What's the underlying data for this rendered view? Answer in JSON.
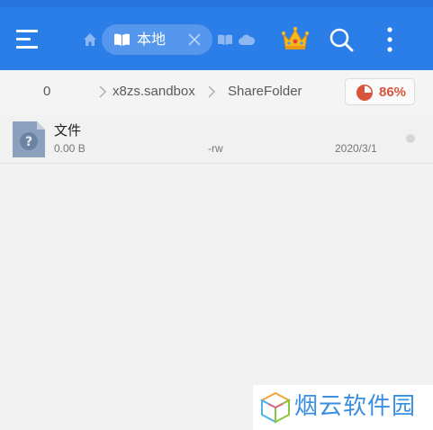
{
  "colors": {
    "appbar": "#2b7de8",
    "background": "#f1f1f1",
    "storage_accent": "#d9543d",
    "watermark_text": "#3a8ee0"
  },
  "appbar": {
    "menu_icon": "hamburger-menu-icon",
    "home_icon": "home-icon",
    "active_tab": {
      "icon": "book-icon",
      "label": "本地",
      "close_icon": "close-icon"
    },
    "extra_icons": [
      "book-icon",
      "cloud-icon"
    ],
    "vip_icon": "crown-icon",
    "search_icon": "search-icon",
    "more_icon": "more-vertical-icon"
  },
  "breadcrumb": {
    "items": [
      "0",
      "x8zs.sandbox",
      "ShareFolder"
    ],
    "storage_usage": "86%",
    "storage_percent": 86
  },
  "files": [
    {
      "name": "文件",
      "size": "0.00 B",
      "permissions": "-rw",
      "date": "2020/3/1",
      "icon": "unknown-file-icon"
    }
  ],
  "watermark": {
    "text": "烟云软件园"
  }
}
